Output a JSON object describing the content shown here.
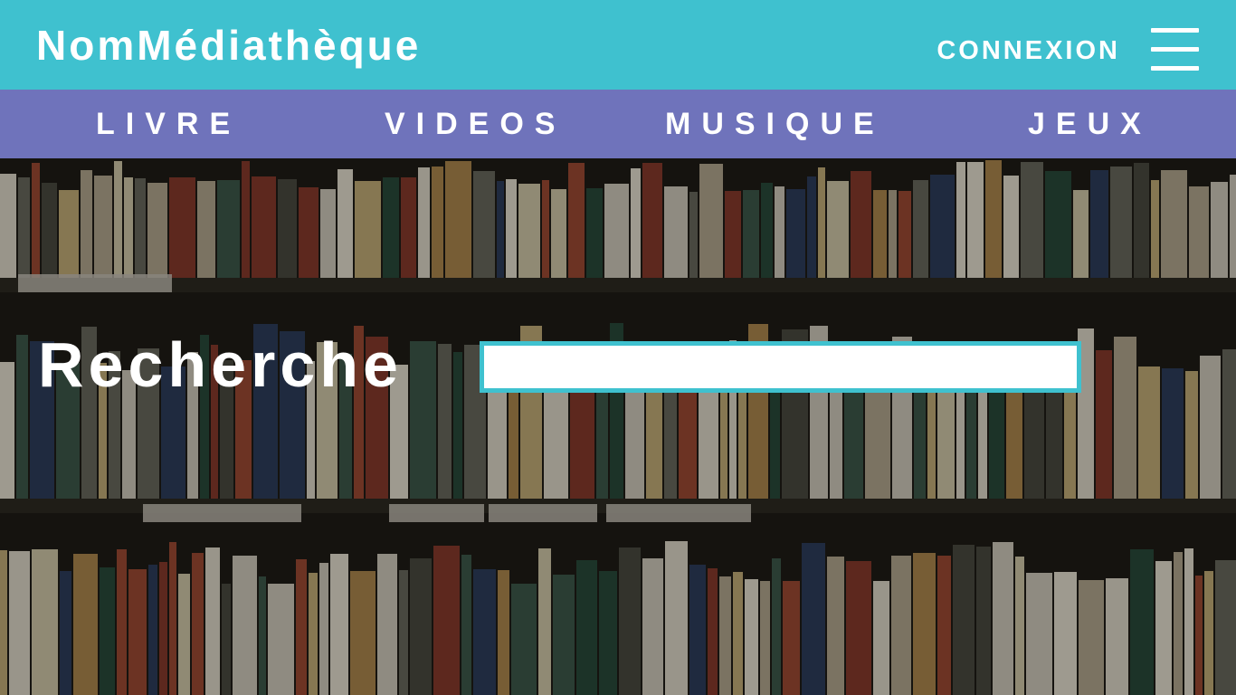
{
  "header": {
    "brand": "NomMédiathèque",
    "login_label": "CONNEXION",
    "menu_icon": "hamburger-menu-icon",
    "background_color": "#3fc1cf"
  },
  "nav": {
    "background_color": "#6f73bb",
    "items": [
      {
        "label": "LIVRE"
      },
      {
        "label": "VIDEOS"
      },
      {
        "label": "MUSIQUE"
      },
      {
        "label": "JEUX"
      }
    ]
  },
  "search": {
    "label": "Recherche",
    "placeholder": "",
    "value": ""
  },
  "hero": {
    "image": "bookshelf-background-image"
  }
}
